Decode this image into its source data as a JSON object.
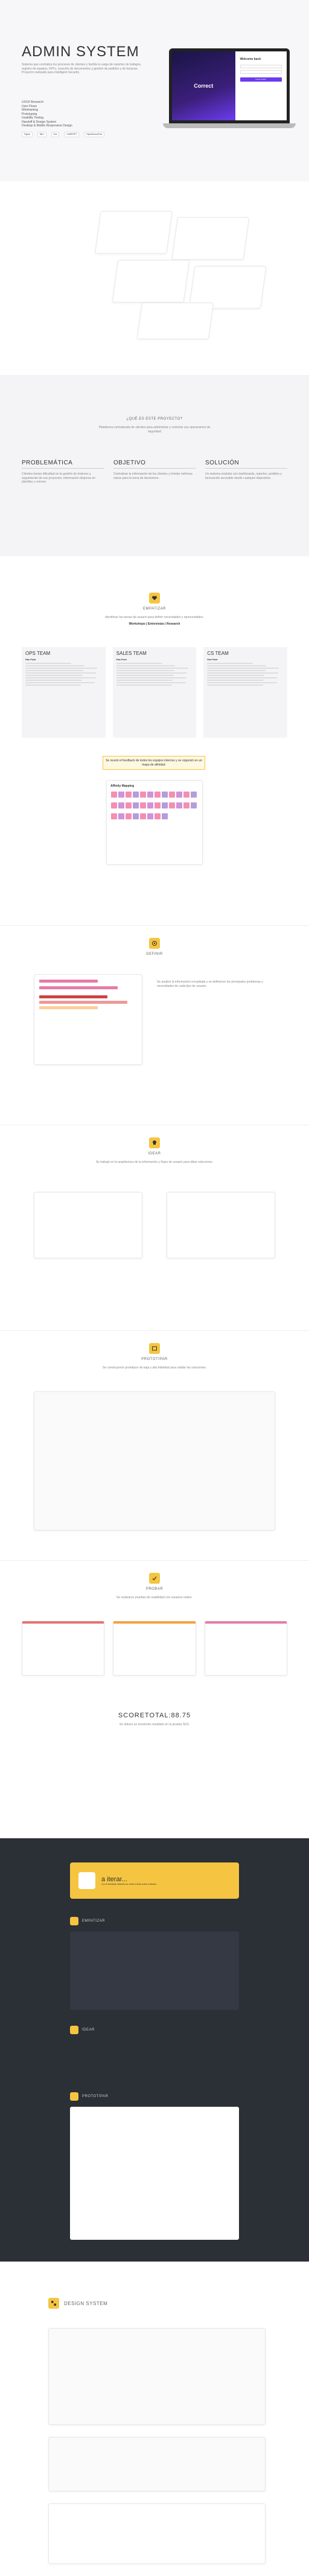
{
  "hero": {
    "title": "ADMIN SYSTEM",
    "description": "Sistema que centraliza los procesos de clientes y facilita la carga de reportes de trabajos, registro de equipos, KPI's, creación de documentos y gestión de pedidos y de facturas. Proyecto realizado para Intelligent Security.",
    "roles": [
      "UX/UI Research",
      "User Flows",
      "Wireframing",
      "Prototyping",
      "Usability Testing",
      "Handoff & Design System",
      "Desktop & Mobile Responsive Design"
    ],
    "tools": [
      "Figma",
      "Miro",
      "Jira",
      "ChatPGPT",
      "OpenSourceTool"
    ],
    "login_brand": "Correct",
    "login_title": "Welcome back",
    "login_button": "Iniciar sesión"
  },
  "project": {
    "label": "¿QUÉ ES ESTE PROYECTO?",
    "intro": "Plataforma centralizada de clientes para administrar y controlar sus operaciones de seguridad",
    "columns": [
      {
        "title": "PROBLEMÁTICA",
        "text": "Clientes tenían dificultad en la gestión de órdenes y seguimiento de sus proyectos; información dispersa en planillas y correos."
      },
      {
        "title": "OBJETIVO",
        "text": "Centralizar la información de los clientes y brindar métricas claras para la toma de decisiones."
      },
      {
        "title": "SOLUCIÓN",
        "text": "Un sistema modular con dashboards, reportes, pedidos y facturación accesible desde cualquier dispositivo."
      }
    ]
  },
  "empathize": {
    "label": "EMPATIZAR",
    "intro": "Identificar las tareas de usuario para definir necesidades y oportunidades.",
    "methods": "Workshops | Entrevistas | Research",
    "teams": [
      {
        "title": "OPS TEAM",
        "sub": "Pain Point"
      },
      {
        "title": "SALES TEAM",
        "sub": "Pain Point"
      },
      {
        "title": "CS TEAM",
        "sub": "Pain Point"
      }
    ],
    "affinity_title": "Affinity Mapping",
    "note": "Se reunió el feedback de todos los equipos internos y se organizó en un mapa de afinidad."
  },
  "define": {
    "label": "DEFINIR",
    "text": "Se analizó la información recopilada y se definieron los principales problemas y necesidades de cada tipo de usuario."
  },
  "ideate": {
    "label": "IDEAR",
    "text": "Se trabajó en la arquitectura de la información y flujos de usuario para idear soluciones."
  },
  "prototype": {
    "label": "PROTOTIPAR",
    "text": "Se construyeron prototipos de baja y alta fidelidad para validar las soluciones."
  },
  "test": {
    "label": "PROBAR",
    "text": "Se realizaron pruebas de usabilidad con usuarios reales.",
    "score": "SCORETOTAL:88.75",
    "score_text": "Se obtuvo un excelente resultado en la prueba SUS."
  },
  "iterate": {
    "title": "a iterar...",
    "text": "Con el feedback obtenido se volvió a iterar sobre el diseño.",
    "steps": [
      "EMPATIZAR",
      "IDEAR",
      "PROTOTIPAR"
    ]
  },
  "design_system": {
    "title": "DESIGN SYSTEM"
  },
  "colors": {
    "accent": "#6c3cf0",
    "yellow": "#f5c542",
    "dark": "#2b2f36"
  }
}
